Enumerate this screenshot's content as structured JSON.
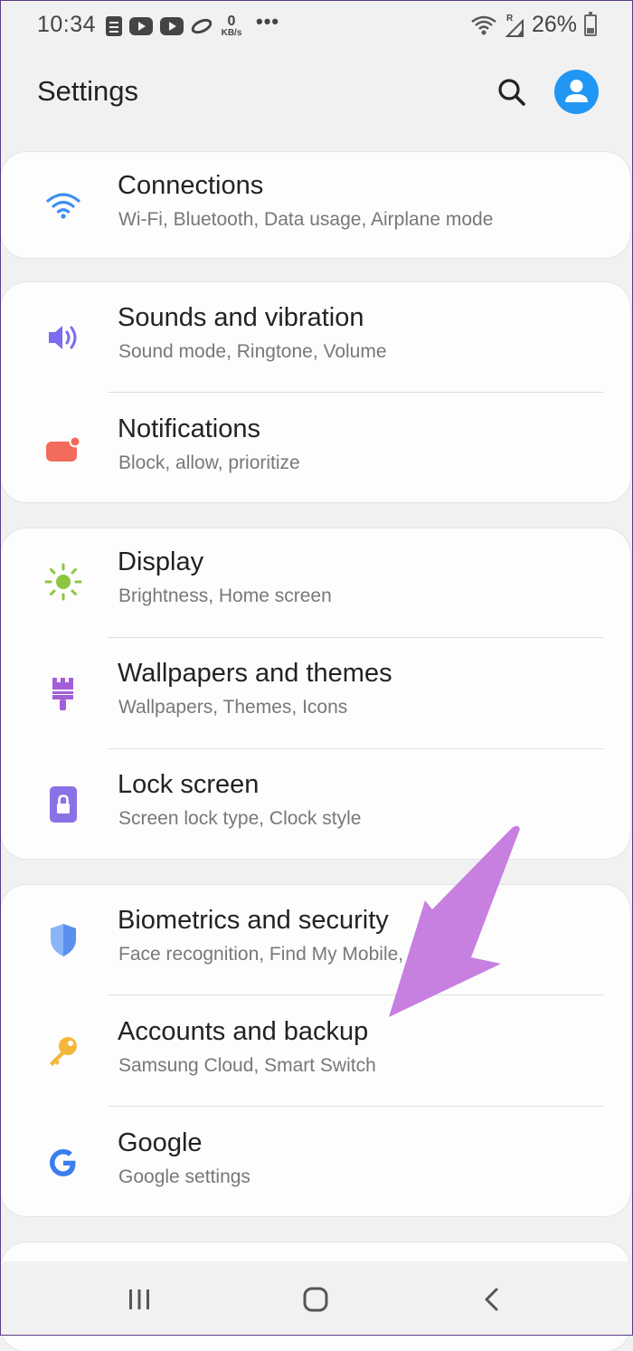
{
  "status_bar": {
    "time": "10:34",
    "network_speed_value": "0",
    "network_speed_unit": "KB/s",
    "more": "•••",
    "signal_letter": "R",
    "battery_percent": "26%"
  },
  "header": {
    "title": "Settings"
  },
  "sections": [
    {
      "items": [
        {
          "title": "Connections",
          "subtitle": "Wi-Fi, Bluetooth, Data usage, Airplane mode",
          "icon": "wifi-icon",
          "color": "#3d8ef0"
        }
      ]
    },
    {
      "items": [
        {
          "title": "Sounds and vibration",
          "subtitle": "Sound mode, Ringtone, Volume",
          "icon": "speaker-icon",
          "color": "#7b6cf0"
        },
        {
          "title": "Notifications",
          "subtitle": "Block, allow, prioritize",
          "icon": "notification-icon",
          "color": "#f26b5d"
        }
      ]
    },
    {
      "items": [
        {
          "title": "Display",
          "subtitle": "Brightness, Home screen",
          "icon": "sun-icon",
          "color": "#8cc63f"
        },
        {
          "title": "Wallpapers and themes",
          "subtitle": "Wallpapers, Themes, Icons",
          "icon": "brush-icon",
          "color": "#a35fd8"
        },
        {
          "title": "Lock screen",
          "subtitle": "Screen lock type, Clock style",
          "icon": "lock-icon",
          "color": "#8a72e6"
        }
      ]
    },
    {
      "items": [
        {
          "title": "Biometrics and security",
          "subtitle": "Face recognition, Find My Mobile, Privacy",
          "icon": "shield-icon",
          "color": "#5b8ff0"
        },
        {
          "title": "Accounts and backup",
          "subtitle": "Samsung Cloud, Smart Switch",
          "icon": "key-icon",
          "color": "#f5b73b"
        },
        {
          "title": "Google",
          "subtitle": "Google settings",
          "icon": "google-icon",
          "color": "#3b7df0"
        }
      ]
    }
  ],
  "colors": {
    "background": "#f1f1f1",
    "card": "#fdfdfd",
    "avatar": "#2196f3",
    "annotation_arrow": "#c77fe0"
  },
  "nav": {
    "recents_icon": "recents-icon",
    "home_icon": "home-icon",
    "back_icon": "back-icon"
  }
}
